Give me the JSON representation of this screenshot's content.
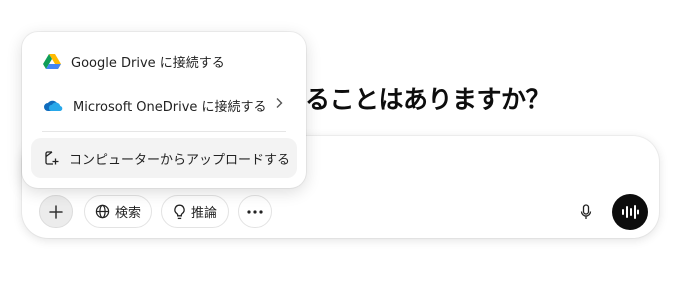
{
  "headline": "ることはありますか？",
  "menu": {
    "items": [
      {
        "label": "Google Drive に接続する",
        "icon": "google-drive-icon"
      },
      {
        "label": "Microsoft OneDrive に接続する",
        "icon": "onedrive-icon",
        "has_submenu": true
      },
      {
        "label": "コンピューターからアップロードする",
        "icon": "upload-file-icon"
      }
    ]
  },
  "toolbar": {
    "search_label": "検索",
    "reason_label": "推論"
  },
  "colors": {
    "voice_button_bg": "#0d0d0d",
    "menu_hover_bg": "#f3f3f3",
    "plus_button_bg": "#ececec"
  }
}
